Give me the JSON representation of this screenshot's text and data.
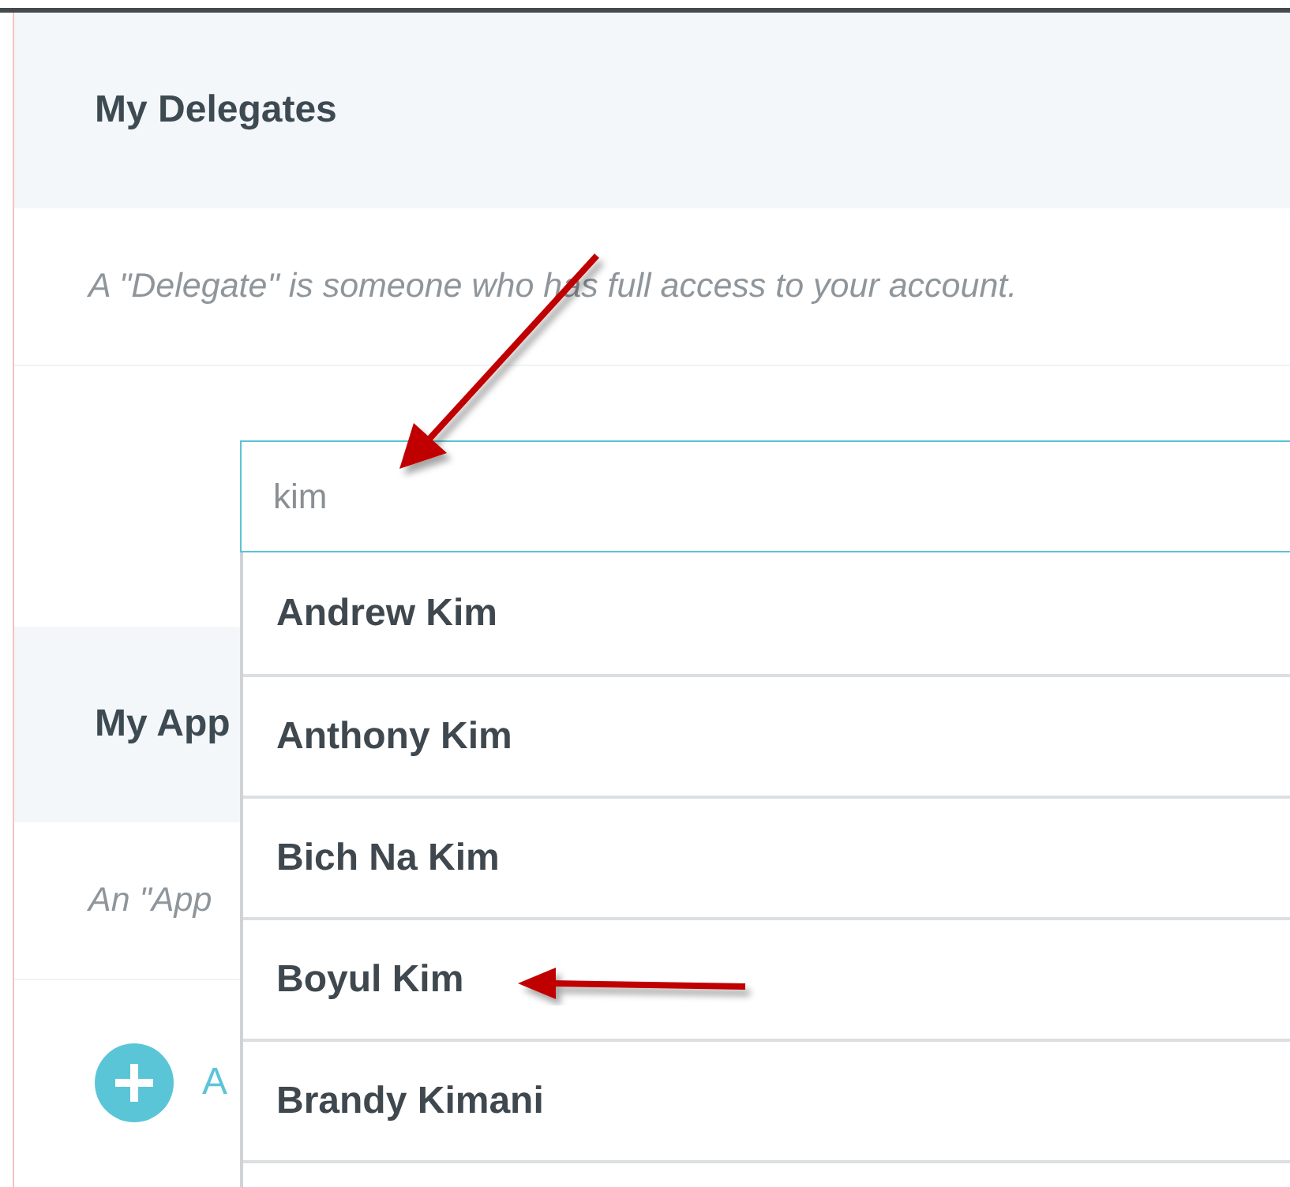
{
  "sections": [
    {
      "title": "My Delegates",
      "description": "A \"Delegate\" is someone who has full access to your account."
    },
    {
      "title": "My App",
      "description": "An \"App"
    }
  ],
  "search": {
    "value": "kim"
  },
  "suggestions": [
    {
      "name": "Andrew Kim"
    },
    {
      "name": "Anthony Kim"
    },
    {
      "name": "Bich Na Kim"
    },
    {
      "name": "Boyul Kim"
    },
    {
      "name": "Brandy Kimani"
    }
  ],
  "add_link": "A"
}
